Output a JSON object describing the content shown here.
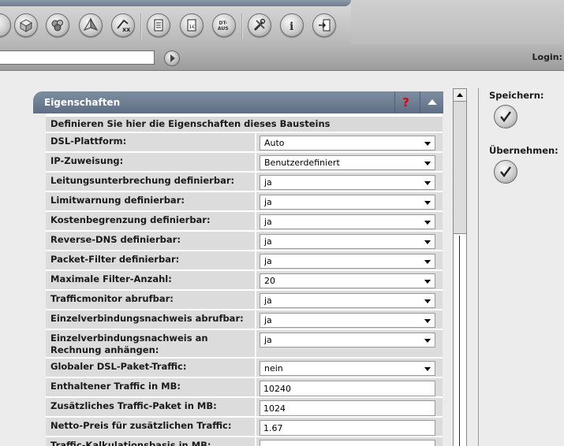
{
  "toolbar": {
    "icons": [
      "partial-round-icon",
      "cube-icon",
      "spheres-icon",
      "pyramid-icon",
      "xx-icon",
      "document-list-icon",
      "euro-document-icon",
      "dt-aus-icon",
      "tools-icon",
      "info-icon",
      "exit-icon"
    ],
    "dt_aus_label_top": "DT-",
    "dt_aus_label_bottom": "AUS",
    "euro_label": "1€",
    "xx_label": "xx",
    "info_label": "i"
  },
  "addressbar": {
    "input_value": "",
    "login_label": "Login:"
  },
  "panel": {
    "title": "Eigenschaften",
    "help_label": "?",
    "subtitle": "Definieren Sie hier die Eigenschaften dieses Bausteins",
    "rows": [
      {
        "label": "DSL-Plattform:",
        "value": "Auto",
        "kind": "select"
      },
      {
        "label": "IP-Zuweisung:",
        "value": "Benutzerdefiniert",
        "kind": "select"
      },
      {
        "label": "Leitungsunterbrechung definierbar:",
        "value": "ja",
        "kind": "select"
      },
      {
        "label": "Limitwarnung definierbar:",
        "value": "ja",
        "kind": "select"
      },
      {
        "label": "Kostenbegrenzung definierbar:",
        "value": "ja",
        "kind": "select"
      },
      {
        "label": "Reverse-DNS definierbar:",
        "value": "ja",
        "kind": "select"
      },
      {
        "label": "Packet-Filter definierbar:",
        "value": "ja",
        "kind": "select"
      },
      {
        "label": "Maximale Filter-Anzahl:",
        "value": "20",
        "kind": "select"
      },
      {
        "label": "Trafficmonitor abrufbar:",
        "value": "ja",
        "kind": "select"
      },
      {
        "label": "Einzelverbindungsnachweis abrufbar:",
        "value": "ja",
        "kind": "select"
      },
      {
        "label": "Einzelverbindungsnachweis an Rechnung anhängen:",
        "value": "ja",
        "kind": "select"
      },
      {
        "label": "Globaler DSL-Paket-Traffic:",
        "value": "nein",
        "kind": "select"
      },
      {
        "label": "Enthaltener Traffic in MB:",
        "value": "10240",
        "kind": "text"
      },
      {
        "label": "Zusätzliches Traffic-Paket in MB:",
        "value": "1024",
        "kind": "text"
      },
      {
        "label": "Netto-Preis für zusätzlichen Traffic:",
        "value": "1.67",
        "kind": "text"
      },
      {
        "label": "Traffic-Kalkulationsbasis in MB:",
        "value": "",
        "kind": "text"
      }
    ]
  },
  "actions": {
    "save_label": "Speichern:",
    "apply_label": "Übernehmen:"
  }
}
